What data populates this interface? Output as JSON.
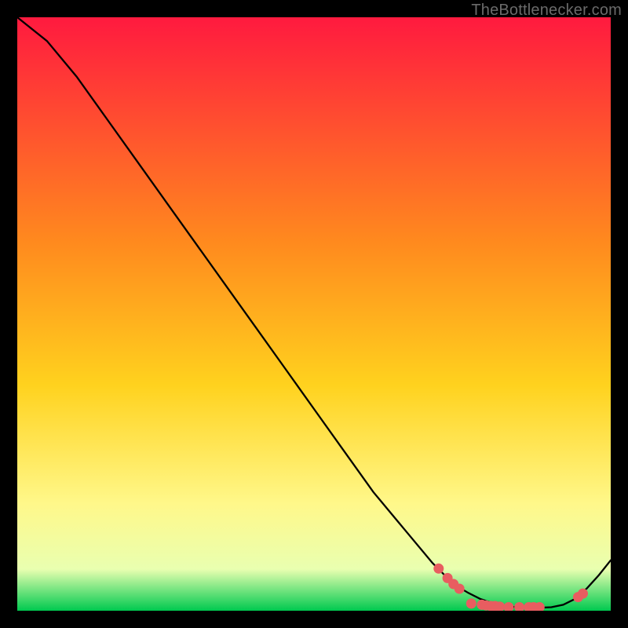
{
  "watermark": "TheBottlenecker.com",
  "colors": {
    "frame": "#000000",
    "line": "#000000",
    "marker": "#e85d60",
    "gradient_top": "#ff1a3f",
    "gradient_mid1": "#ff6a2a",
    "gradient_mid2": "#ffd21e",
    "gradient_mid3": "#fff88a",
    "gradient_mid4": "#e9ffb0",
    "gradient_bottom": "#00c94f"
  },
  "chart_data": {
    "type": "line",
    "title": "",
    "xlabel": "",
    "ylabel": "",
    "xlim": [
      0,
      100
    ],
    "ylim": [
      0,
      100
    ],
    "x": [
      0,
      5,
      10,
      15,
      20,
      25,
      30,
      35,
      40,
      45,
      50,
      55,
      60,
      65,
      70,
      72,
      74,
      76,
      78,
      80,
      82,
      84,
      86,
      88,
      90,
      92,
      94,
      96,
      98,
      100
    ],
    "y": [
      100,
      96,
      90,
      83,
      76,
      69,
      62,
      55,
      48,
      41,
      34,
      27,
      20,
      14,
      8,
      6,
      4.2,
      3,
      2,
      1.3,
      0.9,
      0.6,
      0.5,
      0.5,
      0.6,
      1.0,
      2.0,
      3.8,
      6.0,
      8.5
    ],
    "markers": [
      {
        "x": 71.0,
        "y": 7.1
      },
      {
        "x": 72.5,
        "y": 5.5
      },
      {
        "x": 73.5,
        "y": 4.5
      },
      {
        "x": 74.5,
        "y": 3.7
      },
      {
        "x": 76.5,
        "y": 1.2
      },
      {
        "x": 78.3,
        "y": 1.0
      },
      {
        "x": 79.0,
        "y": 0.9
      },
      {
        "x": 79.8,
        "y": 0.8
      },
      {
        "x": 80.5,
        "y": 0.8
      },
      {
        "x": 81.3,
        "y": 0.7
      },
      {
        "x": 82.8,
        "y": 0.6
      },
      {
        "x": 84.6,
        "y": 0.6
      },
      {
        "x": 86.2,
        "y": 0.6
      },
      {
        "x": 87.0,
        "y": 0.6
      },
      {
        "x": 88.0,
        "y": 0.6
      },
      {
        "x": 94.5,
        "y": 2.3
      },
      {
        "x": 95.3,
        "y": 2.9
      }
    ]
  }
}
